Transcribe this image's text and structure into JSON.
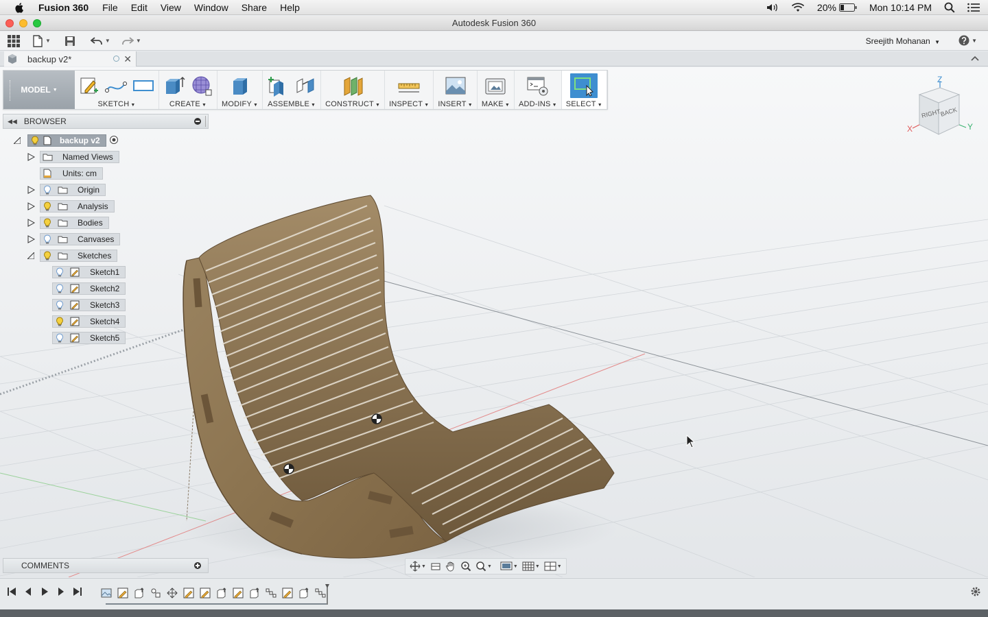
{
  "menubar": {
    "app_name": "Fusion 360",
    "items": [
      "File",
      "Edit",
      "View",
      "Window",
      "Share",
      "Help"
    ],
    "battery": "20%",
    "clock": "Mon 10:14 PM"
  },
  "window": {
    "title": "Autodesk Fusion 360"
  },
  "quick_access": {
    "user_name": "Sreejith Mohanan"
  },
  "document_tab": {
    "name": "backup v2*"
  },
  "ribbon": {
    "workspace": "MODEL",
    "groups": [
      "SKETCH",
      "CREATE",
      "MODIFY",
      "ASSEMBLE",
      "CONSTRUCT",
      "INSPECT",
      "INSERT",
      "MAKE",
      "ADD-INS",
      "SELECT"
    ]
  },
  "viewcube": {
    "top": "Z",
    "x_axis": "X",
    "y_axis": "Y",
    "face_right": "RIGHT",
    "face_back": "BACK"
  },
  "browser": {
    "title": "BROWSER",
    "root": "backup v2",
    "named_views": "Named Views",
    "units": "Units: cm",
    "folders": [
      "Origin",
      "Analysis",
      "Bodies",
      "Canvases",
      "Sketches"
    ],
    "sketches": [
      "Sketch1",
      "Sketch2",
      "Sketch3",
      "Sketch4",
      "Sketch5"
    ]
  },
  "comments": {
    "title": "COMMENTS"
  },
  "colors": {
    "accent": "#3e8ed0",
    "wood": "#8b7350",
    "bulb_on": "#f4d03f",
    "bulb_off": "#8fb3d9"
  }
}
